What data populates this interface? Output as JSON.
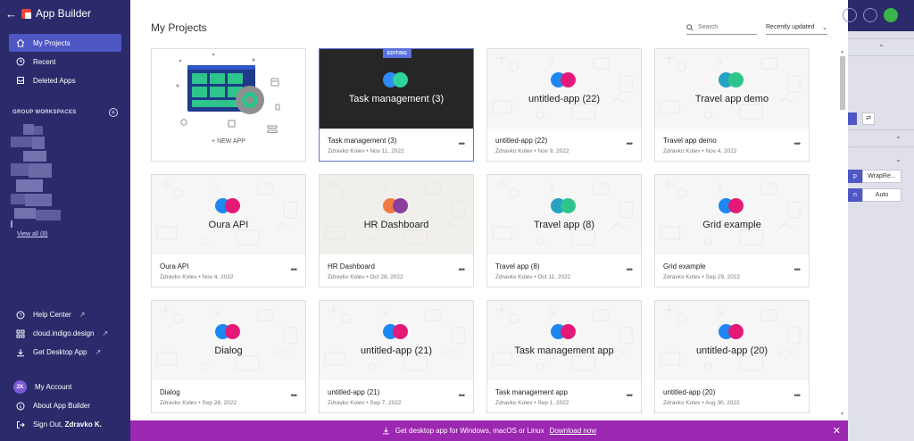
{
  "sidebar": {
    "brand": "App Builder",
    "nav": [
      "My Projects",
      "Recent",
      "Deleted Apps"
    ],
    "group_title": "GROUP WORKSPACES",
    "view_all": "View all (8)",
    "links": [
      "Help Center",
      "cloud.indigo.design",
      "Get Desktop App"
    ],
    "account": {
      "initials": "ZK",
      "my_account": "My Account",
      "about": "About App Builder",
      "sign_out_prefix": "Sign Out,",
      "user_name": "Zdravko K."
    }
  },
  "main": {
    "title": "My Projects",
    "search_placeholder": "Search",
    "sort_label": "Recently updated",
    "new_app_label": "+ NEW APP",
    "editing_badge": "EDITING",
    "projects": [
      {
        "thumb": "Task management (3)",
        "name": "Task management (3)",
        "meta": "Zdravko Kolev • Nov 11, 2022",
        "c1": "#2f8af5",
        "c2": "#2ed39a"
      },
      {
        "thumb": "untitled-app (22)",
        "name": "untitled-app (22)",
        "meta": "Zdravko Kolev • Nov 9, 2022",
        "c1": "#1e88f2",
        "c2": "#e51a78"
      },
      {
        "thumb": "Travel app demo",
        "name": "Travel app demo",
        "meta": "Zdravko Kolev • Nov 4, 2022",
        "c1": "#26a3c4",
        "c2": "#2ec48b"
      },
      {
        "thumb": "Oura API",
        "name": "Oura API",
        "meta": "Zdravko Kolev • Nov 4, 2022",
        "c1": "#1e88f2",
        "c2": "#e51a78"
      },
      {
        "thumb": "HR Dashboard",
        "name": "HR Dashboard",
        "meta": "Zdravko Kolev • Oct 28, 2022",
        "c1": "#f07a42",
        "c2": "#8b3e9e"
      },
      {
        "thumb": "Travel app (8)",
        "name": "Travel app (8)",
        "meta": "Zdravko Kolev • Oct 11, 2022",
        "c1": "#26a3c4",
        "c2": "#2ec48b"
      },
      {
        "thumb": "Grid example",
        "name": "Grid example",
        "meta": "Zdravko Kolev • Sep 29, 2022",
        "c1": "#1e88f2",
        "c2": "#e51a78"
      },
      {
        "thumb": "Dialog",
        "name": "Dialog",
        "meta": "Zdravko Kolev • Sep 28, 2022",
        "c1": "#1e88f2",
        "c2": "#e51a78"
      },
      {
        "thumb": "untitled-app (21)",
        "name": "untitled-app (21)",
        "meta": "Zdravko Kolev • Sep 7, 2022",
        "c1": "#1e88f2",
        "c2": "#e51a78"
      },
      {
        "thumb": "Task management app",
        "name": "Task management app",
        "meta": "Zdravko Kolev • Sep 1, 2022",
        "c1": "#1e88f2",
        "c2": "#e51a78"
      },
      {
        "thumb": "untitled-app (20)",
        "name": "untitled-app (20)",
        "meta": "Zdravko Kolev • Aug 30, 2022",
        "c1": "#1e88f2",
        "c2": "#e51a78"
      }
    ]
  },
  "right_panel": {
    "button_wrap": "WrapRe...",
    "button_n": "n",
    "button_auto": "Auto",
    "button_p": "p"
  },
  "banner": {
    "text": "Get desktop app for Windows, macOS or Linux",
    "link": "Download now"
  },
  "colors": {
    "sidebar_bg": "#2b2b6b",
    "active_nav": "#4e57c4",
    "banner_bg": "#9c27b0",
    "editing_accent": "#5b73e0"
  }
}
